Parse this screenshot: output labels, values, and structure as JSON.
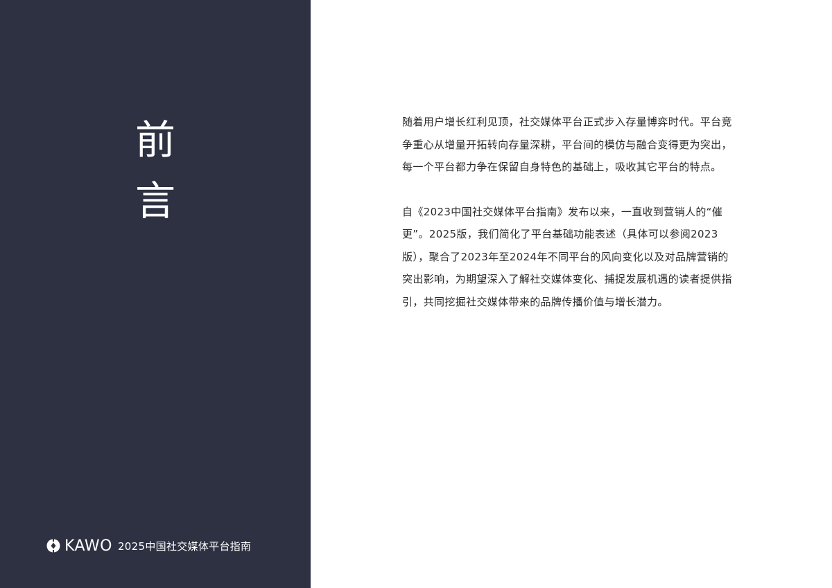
{
  "heading": {
    "char1": "前",
    "char2": "言"
  },
  "brand": {
    "icon": "kawo-logo-icon",
    "name": "KAWO",
    "subtitle": "2025中国社交媒体平台指南"
  },
  "body": {
    "paragraph1": "随着用户增长红利见顶，社交媒体平台正式步入存量博弈时代。平台竞争重心从增量开拓转向存量深耕，平台间的模仿与融合变得更为突出，每一个平台都力争在保留自身特色的基础上，吸收其它平台的特点。",
    "paragraph2": "自《2023中国社交媒体平台指南》发布以来，一直收到营销人的“催更”。2025版，我们简化了平台基础功能表述（具体可以参阅2023版），聚合了2023年至2024年不同平台的风向变化以及对品牌营销的突出影响，为期望深入了解社交媒体变化、捕捉发展机遇的读者提供指引，共同挖掘社交媒体带来的品牌传播价值与增长潜力。"
  },
  "colors": {
    "panel_background": "#2d3142",
    "panel_text": "#ffffff",
    "body_text": "#2b2b2b",
    "page_background": "#ffffff"
  }
}
